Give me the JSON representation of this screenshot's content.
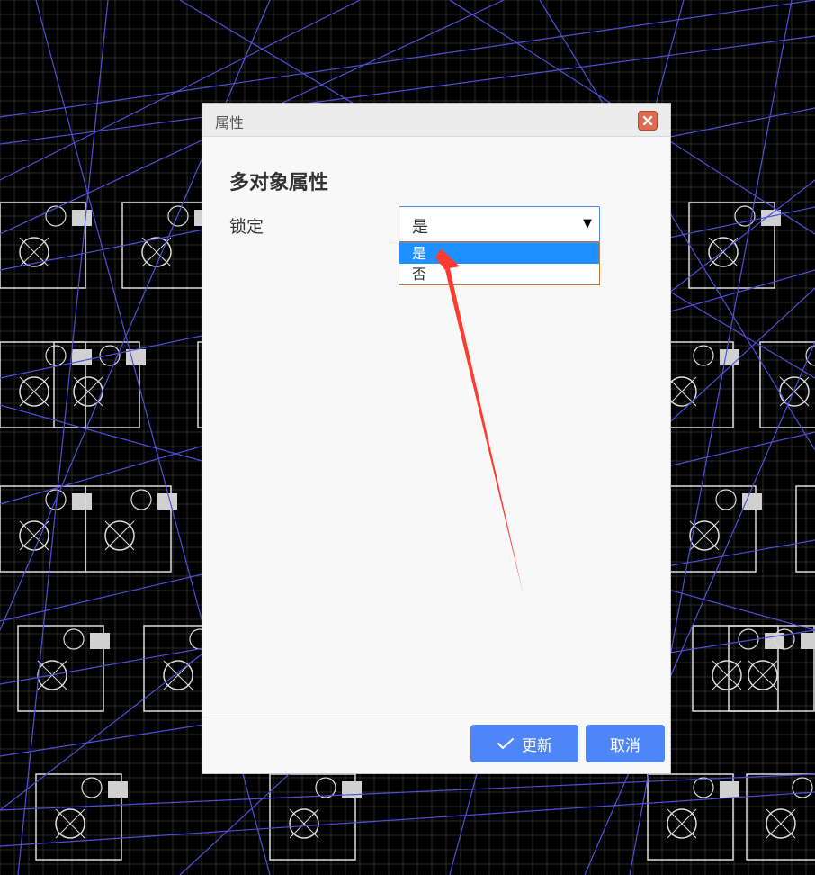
{
  "dialog": {
    "title": "属性",
    "heading": "多对象属性",
    "close_icon": "close-icon"
  },
  "form": {
    "lock": {
      "label": "锁定",
      "value": "是",
      "options": [
        "是",
        "否"
      ],
      "highlighted_option": "是"
    }
  },
  "footer": {
    "update_label": "更新",
    "cancel_label": "取消"
  },
  "colors": {
    "accent": "#4f86f7",
    "highlight": "#1e90ff",
    "close": "#e06a4f",
    "annotation_arrow": "#ff3b2f",
    "background_lines": "#5050d8"
  }
}
